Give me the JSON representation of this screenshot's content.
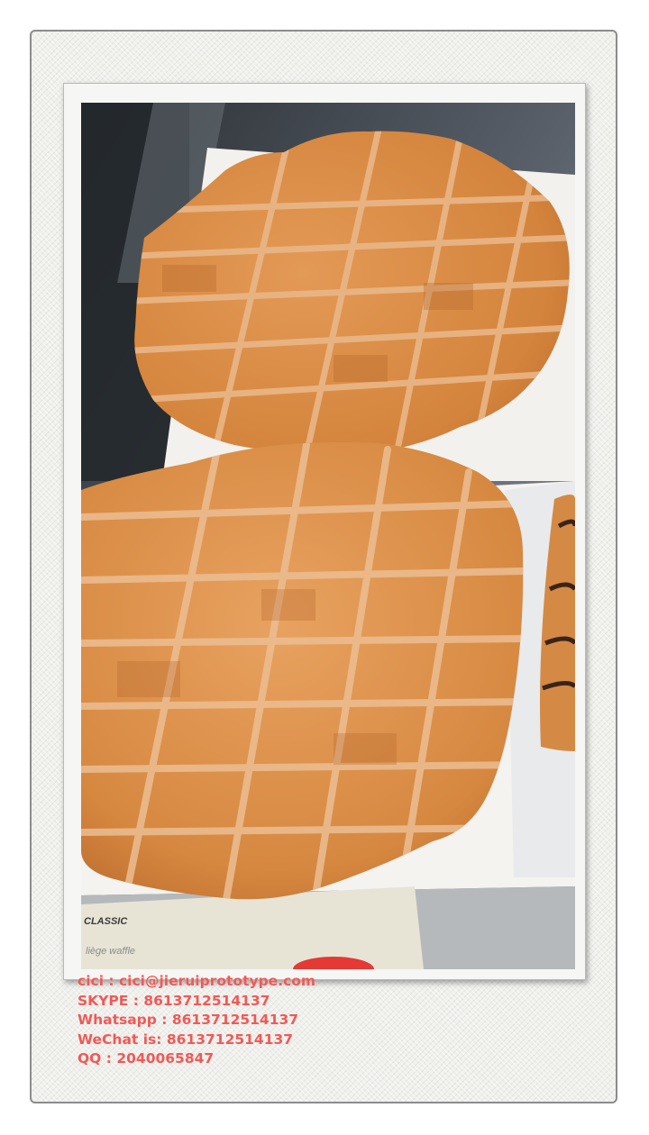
{
  "photo": {
    "box_label": "CLASSIC",
    "box_sublabel": "liège waffle"
  },
  "caption": {
    "email_line": "cici  : cici@jieruiprototype.com",
    "skype_line": "SKYPE : 8613712514137",
    "whatsapp_line": "Whatsapp : 8613712514137",
    "wechat_line": "WeChat is: 8613712514137",
    "qq_line": "QQ : 2040065847"
  },
  "colors": {
    "caption_text": "#ee5a56",
    "waffle_base": "#d5843c",
    "waffle_grid": "#e9b68a"
  }
}
